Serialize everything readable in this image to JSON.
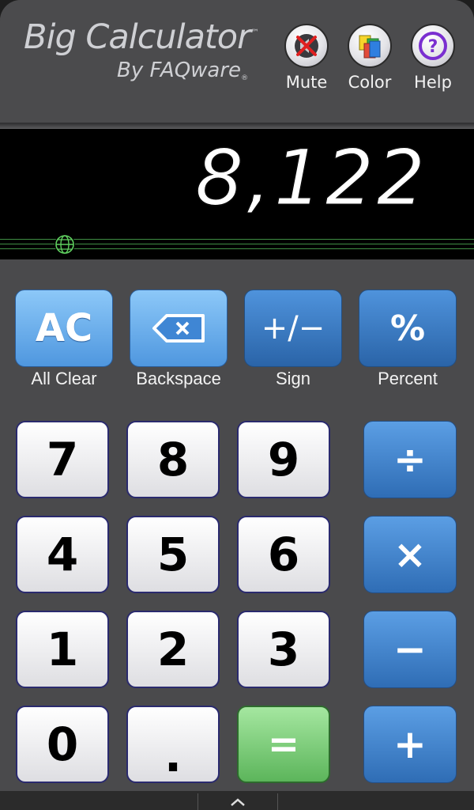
{
  "header": {
    "title": "Big Calculator",
    "tm": "™",
    "subtitle": "By FAQware",
    "reg": "®",
    "buttons": {
      "mute": {
        "label": "Mute",
        "icon": "mute-icon"
      },
      "color": {
        "label": "Color",
        "icon": "color-icon"
      },
      "help": {
        "label": "Help",
        "icon": "help-icon"
      }
    }
  },
  "display": {
    "value": "8,122",
    "icon": "globe-icon"
  },
  "functions": {
    "all_clear": {
      "text": "AC",
      "label": "All Clear"
    },
    "backspace": {
      "label": "Backspace",
      "icon": "backspace-icon"
    },
    "sign": {
      "text": "+/−",
      "label": "Sign"
    },
    "percent": {
      "text": "%",
      "label": "Percent"
    }
  },
  "digits": {
    "d7": "7",
    "d8": "8",
    "d9": "9",
    "d4": "4",
    "d5": "5",
    "d6": "6",
    "d1": "1",
    "d2": "2",
    "d3": "3",
    "d0": "0",
    "dot": "."
  },
  "operators": {
    "divide": "÷",
    "multiply": "×",
    "minus": "−",
    "plus": "+",
    "equals": "="
  },
  "colors": {
    "accent_blue": "#2f6db5",
    "light_blue": "#8cc8f8",
    "equals_green": "#5cb55b",
    "display_bg": "#000000",
    "panel": "#4a4a4c"
  }
}
